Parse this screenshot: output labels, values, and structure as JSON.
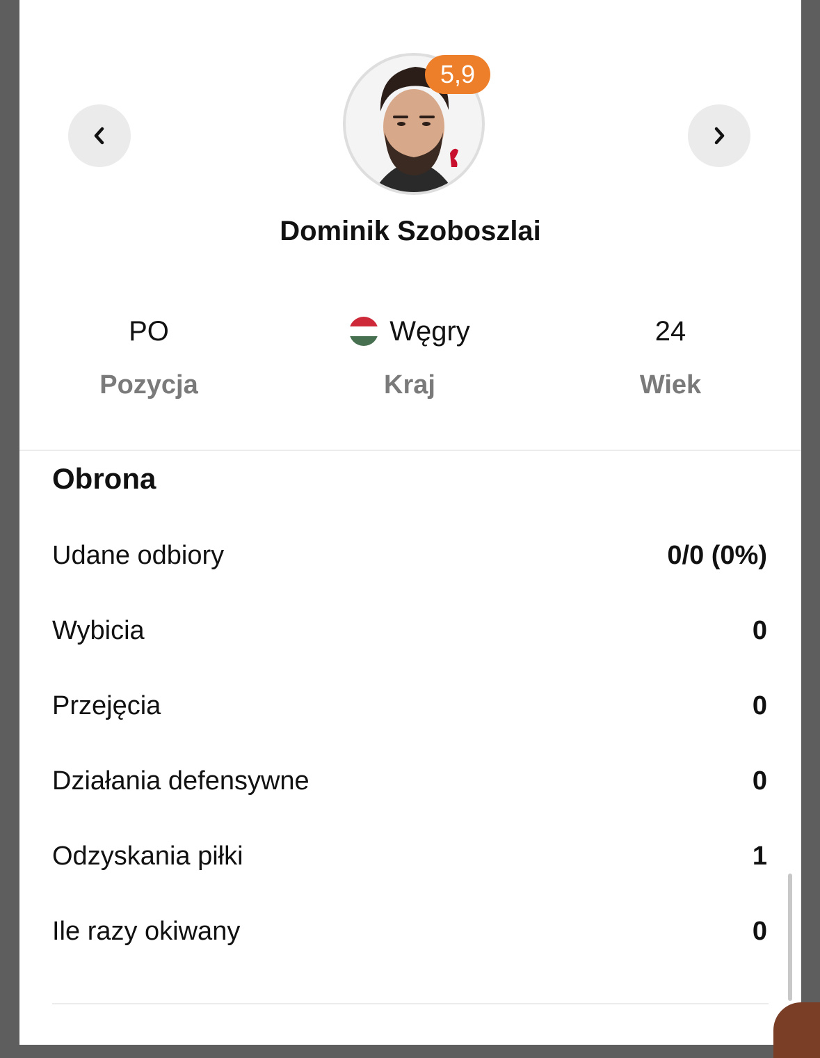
{
  "player": {
    "name": "Dominik Szoboszlai",
    "rating": "5,9",
    "position_value": "PO",
    "position_label": "Pozycja",
    "country_value": "Węgry",
    "country_label": "Kraj",
    "age_value": "24",
    "age_label": "Wiek"
  },
  "colors": {
    "rating_badge": "#ee7f2a",
    "flag_red": "#ce2939",
    "flag_white": "#ffffff",
    "flag_green": "#477050"
  },
  "section": {
    "title": "Obrona",
    "rows": [
      {
        "label": "Udane odbiory",
        "value": "0/0 (0%)"
      },
      {
        "label": "Wybicia",
        "value": "0"
      },
      {
        "label": "Przejęcia",
        "value": "0"
      },
      {
        "label": "Działania defensywne",
        "value": "0"
      },
      {
        "label": "Odzyskania piłki",
        "value": "1"
      },
      {
        "label": "Ile razy okiwany",
        "value": "0"
      }
    ]
  }
}
